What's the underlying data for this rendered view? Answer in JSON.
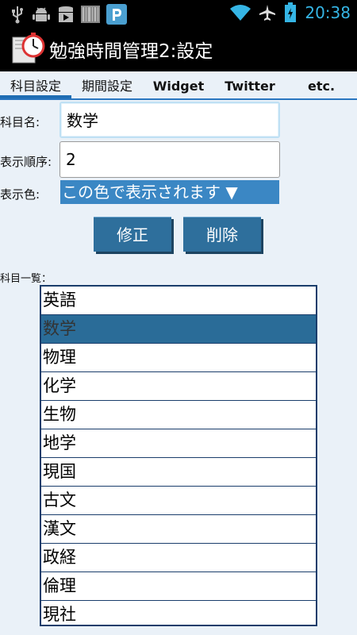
{
  "status_bar": {
    "time": "20:38",
    "left_icons": [
      "usb-icon",
      "android-debug-icon",
      "play-store-icon",
      "barcode-icon",
      "p-app-icon"
    ],
    "right_icons": [
      "wifi-icon",
      "airplane-icon",
      "battery-icon"
    ]
  },
  "app": {
    "title": "勉強時間管理2:設定",
    "icon": "stopwatch-book-icon"
  },
  "tabs": [
    {
      "label": "科目設定",
      "active": true
    },
    {
      "label": "期間設定",
      "active": false
    },
    {
      "label": "Widget",
      "active": false
    },
    {
      "label": "Twitter",
      "active": false
    },
    {
      "label": "etc.",
      "active": false
    }
  ],
  "form": {
    "subject_name_label": "科目名:",
    "subject_name_value": "数学",
    "order_label": "表示順序:",
    "order_value": "2",
    "color_label": "表示色:",
    "color_value": "この色で表示されます ▼",
    "color_hex": "#3b87c4"
  },
  "buttons": {
    "modify": "修正",
    "delete": "削除"
  },
  "subject_list": {
    "label": "科目一覧：",
    "selected_index": 1,
    "items": [
      "英語",
      "数学",
      "物理",
      "化学",
      "生物",
      "地学",
      "現国",
      "古文",
      "漢文",
      "政経",
      "倫理",
      "現社"
    ]
  }
}
